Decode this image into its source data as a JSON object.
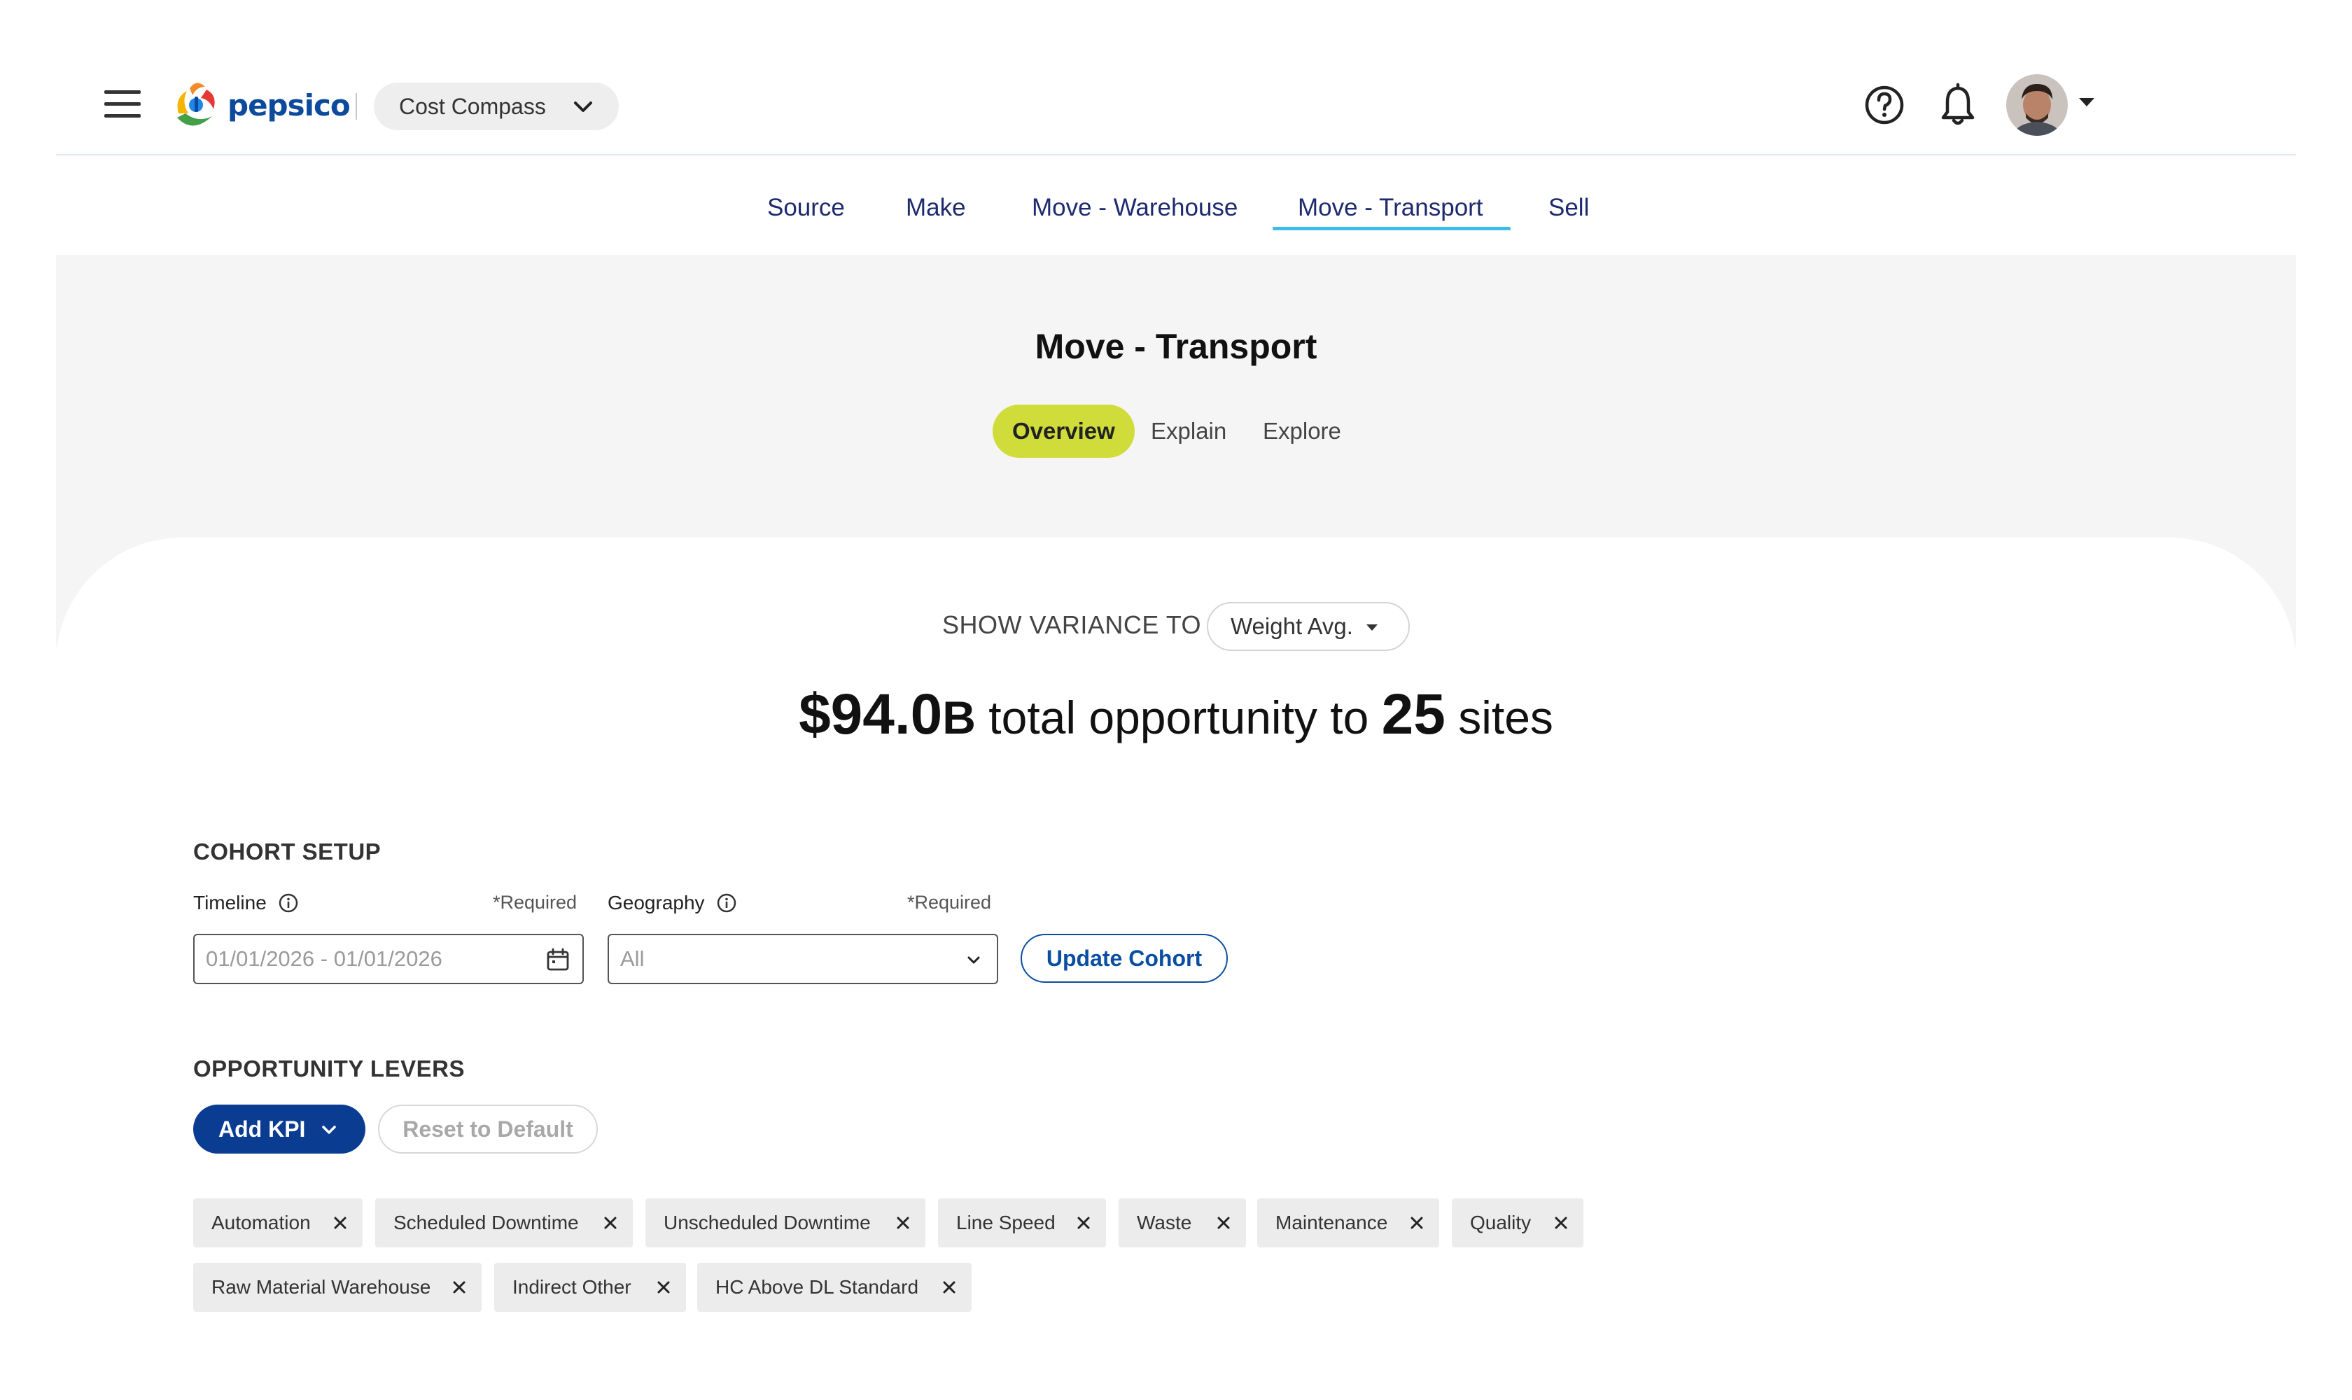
{
  "header": {
    "logo_text": "pepsico",
    "app_switcher_label": "Cost Compass"
  },
  "topnav": {
    "items": [
      {
        "label": "Source"
      },
      {
        "label": "Make"
      },
      {
        "label": "Move - Warehouse"
      },
      {
        "label": "Move - Transport",
        "active": true
      },
      {
        "label": "Sell"
      }
    ]
  },
  "page": {
    "title": "Move - Transport",
    "subtabs": [
      {
        "label": "Overview",
        "active": true
      },
      {
        "label": "Explain"
      },
      {
        "label": "Explore"
      }
    ]
  },
  "variance": {
    "label": "SHOW VARIANCE TO",
    "selected": "Weight Avg."
  },
  "summary": {
    "amount": "$94.0",
    "unit": "B",
    "text_middle": " total opportunity to ",
    "sites_count": "25",
    "text_end": " sites"
  },
  "cohort": {
    "title": "COHORT SETUP",
    "timeline_label": "Timeline",
    "timeline_required": "*Required",
    "timeline_value": "01/01/2026 - 01/01/2026",
    "geography_label": "Geography",
    "geography_required": "*Required",
    "geography_value": "All",
    "update_button": "Update Cohort"
  },
  "levers": {
    "title": "OPPORTUNITY LEVERS",
    "add_kpi_button": "Add KPI",
    "reset_button": "Reset to Default",
    "chips": [
      "Automation",
      "Scheduled Downtime",
      "Unscheduled Downtime",
      "Line Speed",
      "Waste",
      "Maintenance",
      "Quality",
      "Raw Material Warehouse",
      "Indirect Other",
      "HC Above DL Standard"
    ]
  },
  "colors": {
    "brand_blue": "#0a3d91",
    "nav_text": "#1e2a6e",
    "active_underline": "#3dbce8",
    "active_pill": "#cfdc3a"
  }
}
